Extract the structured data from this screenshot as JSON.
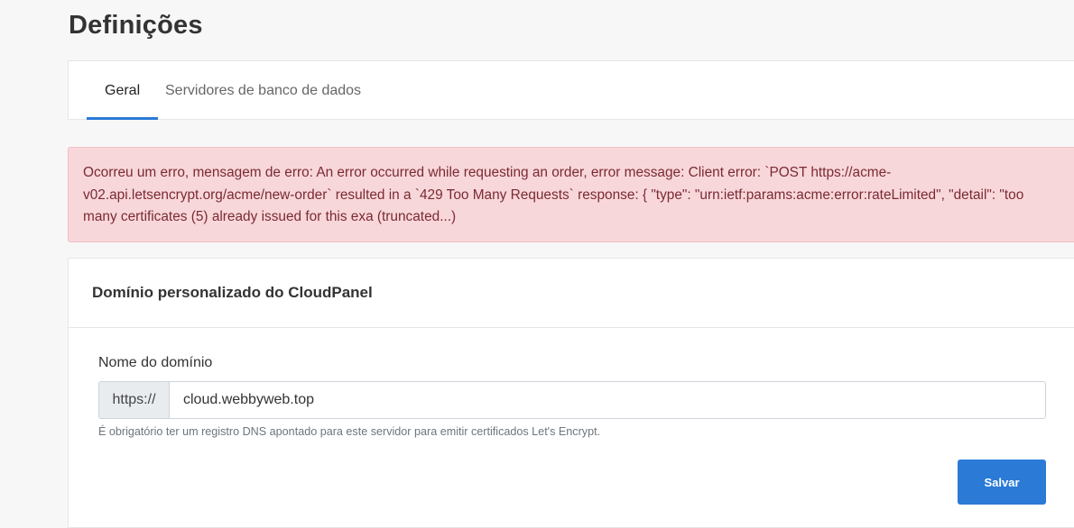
{
  "page": {
    "title": "Definições"
  },
  "tabs": [
    {
      "label": "Geral",
      "active": true
    },
    {
      "label": "Servidores de banco de dados",
      "active": false
    }
  ],
  "alert": {
    "type": "error",
    "message": "Ocorreu um erro, mensagem de erro: An error occurred while requesting an order, error message: Client error: `POST https://acme-v02.api.letsencrypt.org/acme/new-order` resulted in a `429 Too Many Requests` response: { \"type\": \"urn:ietf:params:acme:error:rateLimited\", \"detail\": \"too many certificates (5) already issued for this exa (truncated...)"
  },
  "domain_card": {
    "title": "Domínio personalizado do CloudPanel",
    "field_label": "Nome do domínio",
    "prefix": "https://",
    "value": "cloud.webbyweb.top",
    "help": "É obrigatório ter um registro DNS apontado para este servidor para emitir certificados Let's Encrypt.",
    "save_label": "Salvar"
  },
  "colors": {
    "accent": "#2a7ad6",
    "alert_bg": "#f8d7da",
    "alert_text": "#7a2a33"
  }
}
